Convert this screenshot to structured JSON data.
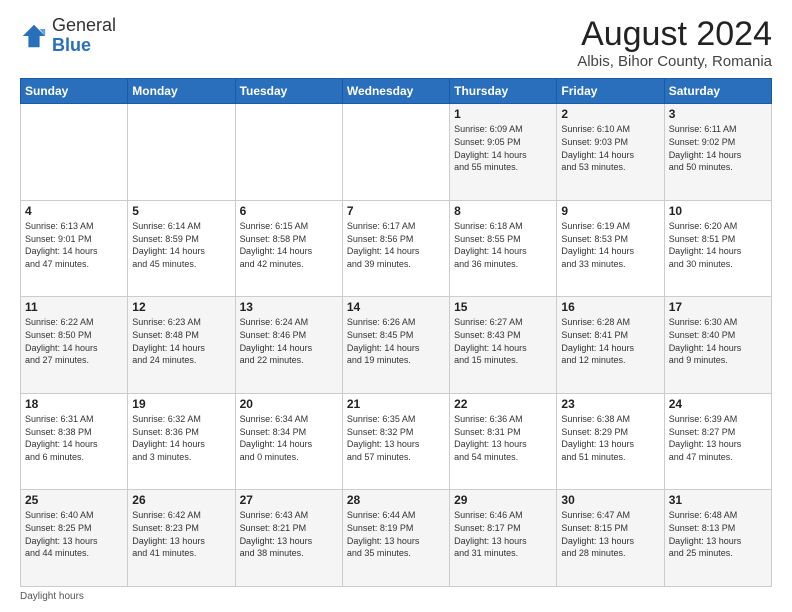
{
  "logo": {
    "general": "General",
    "blue": "Blue"
  },
  "title": "August 2024",
  "subtitle": "Albis, Bihor County, Romania",
  "days_header": [
    "Sunday",
    "Monday",
    "Tuesday",
    "Wednesday",
    "Thursday",
    "Friday",
    "Saturday"
  ],
  "footer": "Daylight hours",
  "weeks": [
    [
      {
        "day": "",
        "info": ""
      },
      {
        "day": "",
        "info": ""
      },
      {
        "day": "",
        "info": ""
      },
      {
        "day": "",
        "info": ""
      },
      {
        "day": "1",
        "info": "Sunrise: 6:09 AM\nSunset: 9:05 PM\nDaylight: 14 hours\nand 55 minutes."
      },
      {
        "day": "2",
        "info": "Sunrise: 6:10 AM\nSunset: 9:03 PM\nDaylight: 14 hours\nand 53 minutes."
      },
      {
        "day": "3",
        "info": "Sunrise: 6:11 AM\nSunset: 9:02 PM\nDaylight: 14 hours\nand 50 minutes."
      }
    ],
    [
      {
        "day": "4",
        "info": "Sunrise: 6:13 AM\nSunset: 9:01 PM\nDaylight: 14 hours\nand 47 minutes."
      },
      {
        "day": "5",
        "info": "Sunrise: 6:14 AM\nSunset: 8:59 PM\nDaylight: 14 hours\nand 45 minutes."
      },
      {
        "day": "6",
        "info": "Sunrise: 6:15 AM\nSunset: 8:58 PM\nDaylight: 14 hours\nand 42 minutes."
      },
      {
        "day": "7",
        "info": "Sunrise: 6:17 AM\nSunset: 8:56 PM\nDaylight: 14 hours\nand 39 minutes."
      },
      {
        "day": "8",
        "info": "Sunrise: 6:18 AM\nSunset: 8:55 PM\nDaylight: 14 hours\nand 36 minutes."
      },
      {
        "day": "9",
        "info": "Sunrise: 6:19 AM\nSunset: 8:53 PM\nDaylight: 14 hours\nand 33 minutes."
      },
      {
        "day": "10",
        "info": "Sunrise: 6:20 AM\nSunset: 8:51 PM\nDaylight: 14 hours\nand 30 minutes."
      }
    ],
    [
      {
        "day": "11",
        "info": "Sunrise: 6:22 AM\nSunset: 8:50 PM\nDaylight: 14 hours\nand 27 minutes."
      },
      {
        "day": "12",
        "info": "Sunrise: 6:23 AM\nSunset: 8:48 PM\nDaylight: 14 hours\nand 24 minutes."
      },
      {
        "day": "13",
        "info": "Sunrise: 6:24 AM\nSunset: 8:46 PM\nDaylight: 14 hours\nand 22 minutes."
      },
      {
        "day": "14",
        "info": "Sunrise: 6:26 AM\nSunset: 8:45 PM\nDaylight: 14 hours\nand 19 minutes."
      },
      {
        "day": "15",
        "info": "Sunrise: 6:27 AM\nSunset: 8:43 PM\nDaylight: 14 hours\nand 15 minutes."
      },
      {
        "day": "16",
        "info": "Sunrise: 6:28 AM\nSunset: 8:41 PM\nDaylight: 14 hours\nand 12 minutes."
      },
      {
        "day": "17",
        "info": "Sunrise: 6:30 AM\nSunset: 8:40 PM\nDaylight: 14 hours\nand 9 minutes."
      }
    ],
    [
      {
        "day": "18",
        "info": "Sunrise: 6:31 AM\nSunset: 8:38 PM\nDaylight: 14 hours\nand 6 minutes."
      },
      {
        "day": "19",
        "info": "Sunrise: 6:32 AM\nSunset: 8:36 PM\nDaylight: 14 hours\nand 3 minutes."
      },
      {
        "day": "20",
        "info": "Sunrise: 6:34 AM\nSunset: 8:34 PM\nDaylight: 14 hours\nand 0 minutes."
      },
      {
        "day": "21",
        "info": "Sunrise: 6:35 AM\nSunset: 8:32 PM\nDaylight: 13 hours\nand 57 minutes."
      },
      {
        "day": "22",
        "info": "Sunrise: 6:36 AM\nSunset: 8:31 PM\nDaylight: 13 hours\nand 54 minutes."
      },
      {
        "day": "23",
        "info": "Sunrise: 6:38 AM\nSunset: 8:29 PM\nDaylight: 13 hours\nand 51 minutes."
      },
      {
        "day": "24",
        "info": "Sunrise: 6:39 AM\nSunset: 8:27 PM\nDaylight: 13 hours\nand 47 minutes."
      }
    ],
    [
      {
        "day": "25",
        "info": "Sunrise: 6:40 AM\nSunset: 8:25 PM\nDaylight: 13 hours\nand 44 minutes."
      },
      {
        "day": "26",
        "info": "Sunrise: 6:42 AM\nSunset: 8:23 PM\nDaylight: 13 hours\nand 41 minutes."
      },
      {
        "day": "27",
        "info": "Sunrise: 6:43 AM\nSunset: 8:21 PM\nDaylight: 13 hours\nand 38 minutes."
      },
      {
        "day": "28",
        "info": "Sunrise: 6:44 AM\nSunset: 8:19 PM\nDaylight: 13 hours\nand 35 minutes."
      },
      {
        "day": "29",
        "info": "Sunrise: 6:46 AM\nSunset: 8:17 PM\nDaylight: 13 hours\nand 31 minutes."
      },
      {
        "day": "30",
        "info": "Sunrise: 6:47 AM\nSunset: 8:15 PM\nDaylight: 13 hours\nand 28 minutes."
      },
      {
        "day": "31",
        "info": "Sunrise: 6:48 AM\nSunset: 8:13 PM\nDaylight: 13 hours\nand 25 minutes."
      }
    ]
  ]
}
